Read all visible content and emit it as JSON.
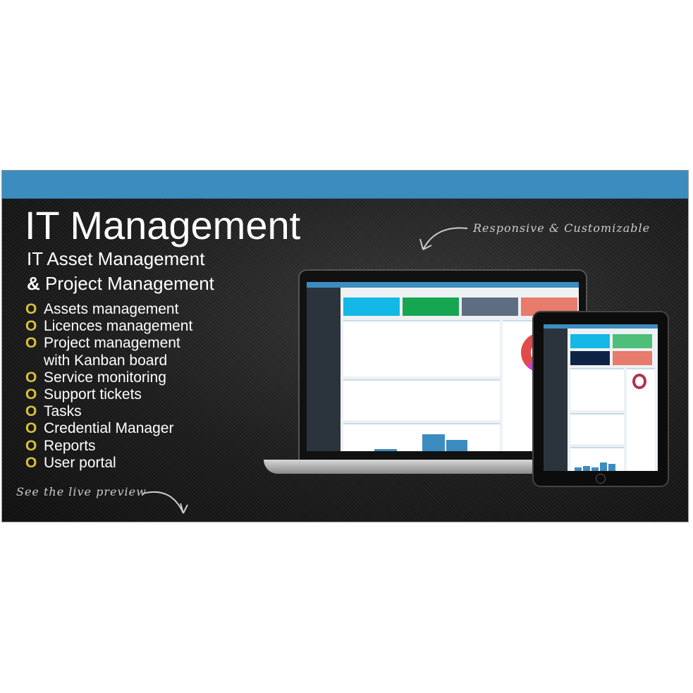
{
  "banner": {
    "title": "IT Management",
    "subtitle_1": "IT Asset Management",
    "subtitle_2_amp": "&",
    "subtitle_2": " Project Management",
    "bullet_glyph": "O",
    "features": [
      "Assets management",
      "Licences management",
      "Project management",
      "with Kanban board",
      "Service monitoring",
      "Support tickets",
      "Tasks",
      "Credential Manager",
      "Reports",
      "User portal"
    ],
    "tagline": "Responsive & Customizable",
    "cta": "See the live preview"
  },
  "colors": {
    "header_blue": "#3d8cbf",
    "bullet": "#d8c23a",
    "card_cyan": "#14b8e6",
    "card_green": "#16a652",
    "card_navy": "#0e2447",
    "card_salmon": "#e77b6c"
  }
}
